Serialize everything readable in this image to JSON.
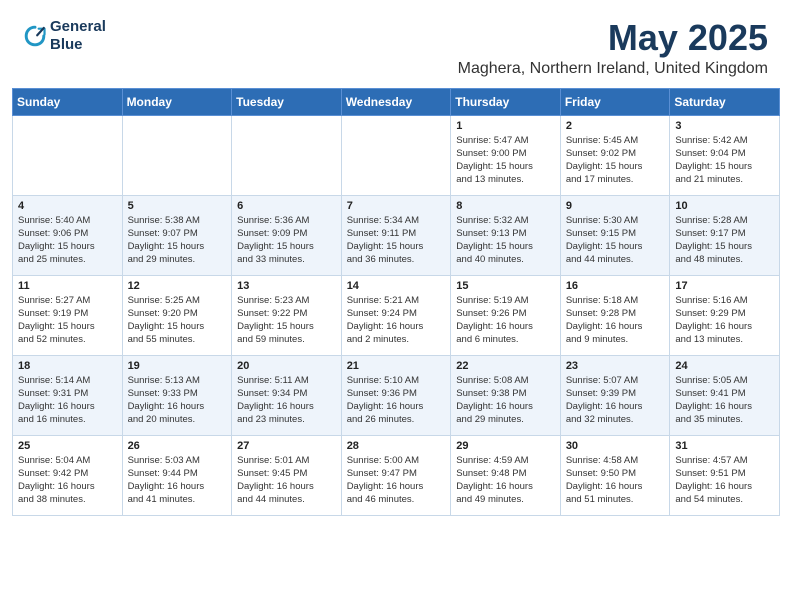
{
  "logo": {
    "line1": "General",
    "line2": "Blue"
  },
  "title": "May 2025",
  "location": "Maghera, Northern Ireland, United Kingdom",
  "weekdays": [
    "Sunday",
    "Monday",
    "Tuesday",
    "Wednesday",
    "Thursday",
    "Friday",
    "Saturday"
  ],
  "weeks": [
    [
      {
        "day": "",
        "info": ""
      },
      {
        "day": "",
        "info": ""
      },
      {
        "day": "",
        "info": ""
      },
      {
        "day": "",
        "info": ""
      },
      {
        "day": "1",
        "info": "Sunrise: 5:47 AM\nSunset: 9:00 PM\nDaylight: 15 hours\nand 13 minutes."
      },
      {
        "day": "2",
        "info": "Sunrise: 5:45 AM\nSunset: 9:02 PM\nDaylight: 15 hours\nand 17 minutes."
      },
      {
        "day": "3",
        "info": "Sunrise: 5:42 AM\nSunset: 9:04 PM\nDaylight: 15 hours\nand 21 minutes."
      }
    ],
    [
      {
        "day": "4",
        "info": "Sunrise: 5:40 AM\nSunset: 9:06 PM\nDaylight: 15 hours\nand 25 minutes."
      },
      {
        "day": "5",
        "info": "Sunrise: 5:38 AM\nSunset: 9:07 PM\nDaylight: 15 hours\nand 29 minutes."
      },
      {
        "day": "6",
        "info": "Sunrise: 5:36 AM\nSunset: 9:09 PM\nDaylight: 15 hours\nand 33 minutes."
      },
      {
        "day": "7",
        "info": "Sunrise: 5:34 AM\nSunset: 9:11 PM\nDaylight: 15 hours\nand 36 minutes."
      },
      {
        "day": "8",
        "info": "Sunrise: 5:32 AM\nSunset: 9:13 PM\nDaylight: 15 hours\nand 40 minutes."
      },
      {
        "day": "9",
        "info": "Sunrise: 5:30 AM\nSunset: 9:15 PM\nDaylight: 15 hours\nand 44 minutes."
      },
      {
        "day": "10",
        "info": "Sunrise: 5:28 AM\nSunset: 9:17 PM\nDaylight: 15 hours\nand 48 minutes."
      }
    ],
    [
      {
        "day": "11",
        "info": "Sunrise: 5:27 AM\nSunset: 9:19 PM\nDaylight: 15 hours\nand 52 minutes."
      },
      {
        "day": "12",
        "info": "Sunrise: 5:25 AM\nSunset: 9:20 PM\nDaylight: 15 hours\nand 55 minutes."
      },
      {
        "day": "13",
        "info": "Sunrise: 5:23 AM\nSunset: 9:22 PM\nDaylight: 15 hours\nand 59 minutes."
      },
      {
        "day": "14",
        "info": "Sunrise: 5:21 AM\nSunset: 9:24 PM\nDaylight: 16 hours\nand 2 minutes."
      },
      {
        "day": "15",
        "info": "Sunrise: 5:19 AM\nSunset: 9:26 PM\nDaylight: 16 hours\nand 6 minutes."
      },
      {
        "day": "16",
        "info": "Sunrise: 5:18 AM\nSunset: 9:28 PM\nDaylight: 16 hours\nand 9 minutes."
      },
      {
        "day": "17",
        "info": "Sunrise: 5:16 AM\nSunset: 9:29 PM\nDaylight: 16 hours\nand 13 minutes."
      }
    ],
    [
      {
        "day": "18",
        "info": "Sunrise: 5:14 AM\nSunset: 9:31 PM\nDaylight: 16 hours\nand 16 minutes."
      },
      {
        "day": "19",
        "info": "Sunrise: 5:13 AM\nSunset: 9:33 PM\nDaylight: 16 hours\nand 20 minutes."
      },
      {
        "day": "20",
        "info": "Sunrise: 5:11 AM\nSunset: 9:34 PM\nDaylight: 16 hours\nand 23 minutes."
      },
      {
        "day": "21",
        "info": "Sunrise: 5:10 AM\nSunset: 9:36 PM\nDaylight: 16 hours\nand 26 minutes."
      },
      {
        "day": "22",
        "info": "Sunrise: 5:08 AM\nSunset: 9:38 PM\nDaylight: 16 hours\nand 29 minutes."
      },
      {
        "day": "23",
        "info": "Sunrise: 5:07 AM\nSunset: 9:39 PM\nDaylight: 16 hours\nand 32 minutes."
      },
      {
        "day": "24",
        "info": "Sunrise: 5:05 AM\nSunset: 9:41 PM\nDaylight: 16 hours\nand 35 minutes."
      }
    ],
    [
      {
        "day": "25",
        "info": "Sunrise: 5:04 AM\nSunset: 9:42 PM\nDaylight: 16 hours\nand 38 minutes."
      },
      {
        "day": "26",
        "info": "Sunrise: 5:03 AM\nSunset: 9:44 PM\nDaylight: 16 hours\nand 41 minutes."
      },
      {
        "day": "27",
        "info": "Sunrise: 5:01 AM\nSunset: 9:45 PM\nDaylight: 16 hours\nand 44 minutes."
      },
      {
        "day": "28",
        "info": "Sunrise: 5:00 AM\nSunset: 9:47 PM\nDaylight: 16 hours\nand 46 minutes."
      },
      {
        "day": "29",
        "info": "Sunrise: 4:59 AM\nSunset: 9:48 PM\nDaylight: 16 hours\nand 49 minutes."
      },
      {
        "day": "30",
        "info": "Sunrise: 4:58 AM\nSunset: 9:50 PM\nDaylight: 16 hours\nand 51 minutes."
      },
      {
        "day": "31",
        "info": "Sunrise: 4:57 AM\nSunset: 9:51 PM\nDaylight: 16 hours\nand 54 minutes."
      }
    ]
  ]
}
